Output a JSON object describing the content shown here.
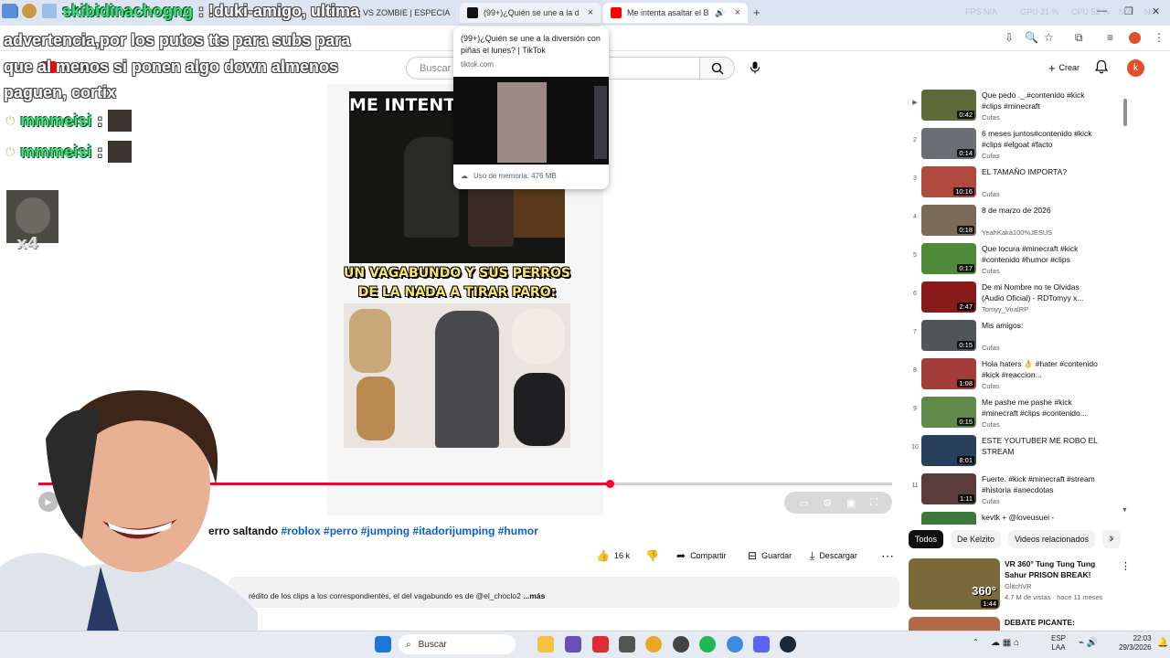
{
  "browser": {
    "tabs": [
      {
        "label": "R VS ZOMBIE | ESPECIA",
        "color": "#ff0000"
      },
      {
        "label": "(99+)¿Quién se une a la diversió",
        "color": "#111111"
      },
      {
        "label": "Me intenta asaltar el Brayan",
        "color": "#ff0000"
      }
    ],
    "new_tab": "+",
    "close": "×",
    "stats": {
      "fps": "FPS N/A",
      "gpu": "GPU 21 %",
      "cpu": "CPU 52 %",
      "mem": "N/A",
      "extra": "N/A"
    }
  },
  "tooltip": {
    "title": "(99+)¿Quién se une a la diversión con piñas el lunes? | TikTok",
    "url": "tiktok.com",
    "memory": "Uso de memoria: 476 MB"
  },
  "overlay": {
    "top_chat_user": "skibidinachogng",
    "top_chat_text": ": !duki-amigo, ultima",
    "tts_message": "advertencia,por los putos tts para subs para que al menos si ponen algo down almenos paguen, cortix",
    "chat_lines": [
      {
        "user": "mmmeisi",
        "sep": ":"
      },
      {
        "user": "mmmeisi",
        "sep": ":"
      }
    ],
    "multiplier": "x4"
  },
  "youtube": {
    "logo_text": "YouTube",
    "search_placeholder": "Buscar",
    "create_label": "Crear",
    "avatar_letter": "k",
    "video": {
      "caption_top": "ME INTENTA ASALTAR",
      "caption_mid": "UN VAGABUNDO Y SUS PERROS DE LA NADA A TIRAR PARO:",
      "progress": 0.669,
      "title_prefix": "erro saltando",
      "title_tags": "#roblox #perro #jumping #itadorijumping #humor",
      "likes": "16 k",
      "share": "Compartir",
      "save": "Guardar",
      "download": "Descargar",
      "description": "rédito de los clips a los correspondientes, el del vagabundo es de @el_choclo2",
      "more": "...más"
    },
    "playlist": [
      {
        "idx": "▶",
        "title": "Que pedo ._.#contenido #kick #clips #minecraft",
        "channel": "Cufas",
        "duration": "0:42",
        "color": "#5d6b3a"
      },
      {
        "idx": "2",
        "title": "6 meses juntos#contenido #kick #clips #elgoat #facto",
        "channel": "Cufas",
        "duration": "0:14",
        "color": "#6b6f73"
      },
      {
        "idx": "3",
        "title": "EL TAMAÑO IMPORTA?",
        "channel": "Cufas",
        "duration": "10:16",
        "color": "#b04a3e"
      },
      {
        "idx": "4",
        "title": "8 de marzo de 2026",
        "channel": "YeahKakà100%JESUS",
        "duration": "0:18",
        "color": "#7a6a58"
      },
      {
        "idx": "5",
        "title": "Que locura #minecraft #kick #contenido #humor #clips",
        "channel": "Cufas",
        "duration": "0:17",
        "color": "#4e8a3a"
      },
      {
        "idx": "6",
        "title": "De mi Nombre no te Olvidas (Audio Oficial) - RDTomyy x...",
        "channel": "Tomyy_ViralRP",
        "duration": "2:47",
        "color": "#8a1a1a"
      },
      {
        "idx": "7",
        "title": "Mis amigos:",
        "channel": "Cufas",
        "duration": "0:15",
        "color": "#505658"
      },
      {
        "idx": "8",
        "title": "Hola haters 👌 #hater #contenido #kick #reaccion...",
        "channel": "Cufas",
        "duration": "1:08",
        "color": "#a23d3a"
      },
      {
        "idx": "9",
        "title": "Me pashe me pashe #kick #minecraft #clips #contenido...",
        "channel": "Cufas",
        "duration": "0:15",
        "color": "#5f8a4a"
      },
      {
        "idx": "10",
        "title": "ESTE YOUTUBER ME ROBO EL STREAM",
        "channel": "",
        "duration": "8:01",
        "color": "#28405a"
      },
      {
        "idx": "11",
        "title": "Fuerte. #kick #minecraft #stream #historia #anecdotas",
        "channel": "Cufas",
        "duration": "1:11",
        "color": "#5a3d3a"
      },
      {
        "idx": "",
        "title": "kevtk + @loveusuei -",
        "channel": "",
        "duration": "",
        "color": "#3d7a3a"
      }
    ],
    "chips": [
      "Todos",
      "De Kelzito",
      "Videos relacionados",
      "P"
    ],
    "recommended": [
      {
        "title": "VR 360° Tung Tung Tung Sahur PRISON BREAK!",
        "channel": "GlitchVR",
        "meta": "4.7 M de vistas · hace 11 meses",
        "badge": "360°",
        "duration": "1:44",
        "color": "#7a6a3a"
      },
      {
        "title": "DEBATE PICANTE: THERIANS",
        "channel": "",
        "meta": "",
        "badge": "",
        "duration": "",
        "color": "#b06a4a"
      }
    ]
  },
  "taskbar": {
    "search": "Buscar",
    "lang": "ESP",
    "lang2": "LAA",
    "time": "22:03",
    "date": "29/3/2026"
  }
}
